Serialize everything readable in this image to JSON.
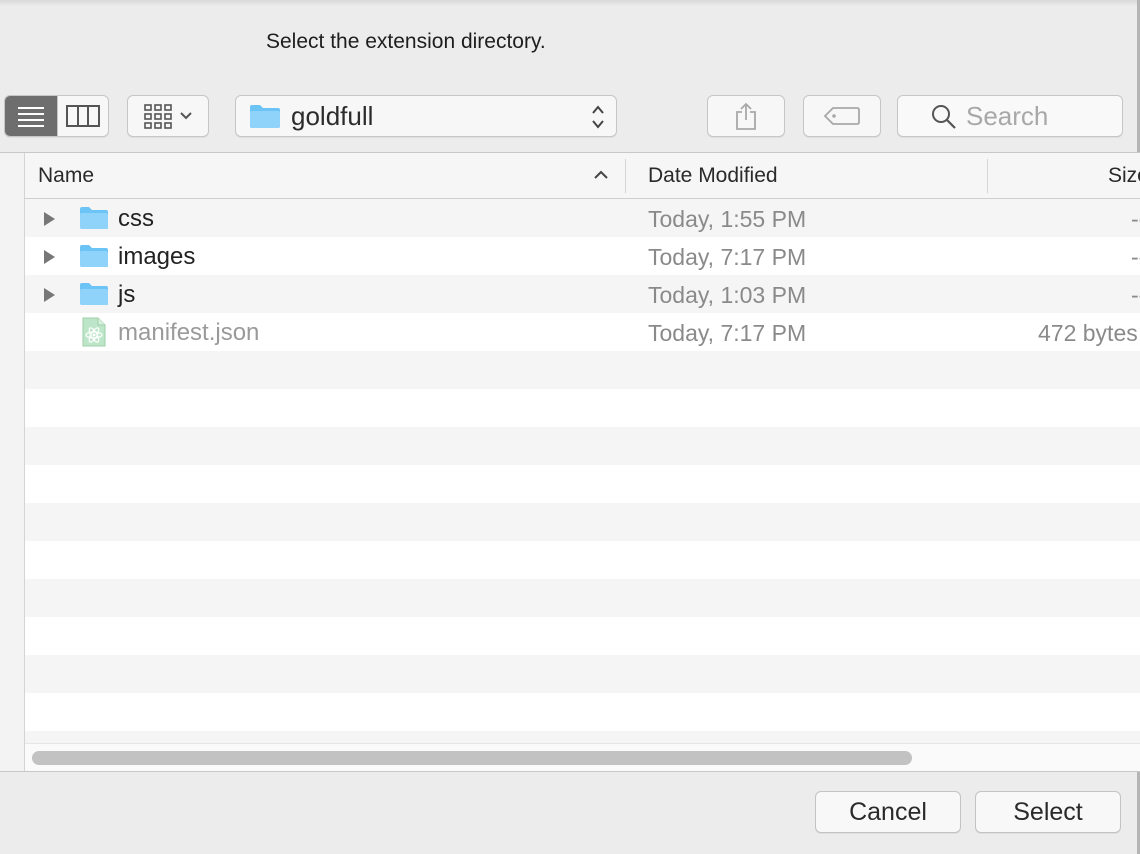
{
  "dialog": {
    "prompt": "Select the extension directory."
  },
  "toolbar": {
    "view_modes": [
      {
        "name": "list-view",
        "icon": "list-icon",
        "active": true
      },
      {
        "name": "column-view",
        "icon": "columns-icon",
        "active": false
      }
    ],
    "arrange_icon": "grid-icon",
    "path_popup": {
      "label": "goldfull",
      "icon": "folder-icon"
    },
    "share_icon": "share-icon",
    "tag_icon": "tag-icon",
    "search": {
      "placeholder": "Search",
      "value": ""
    }
  },
  "browser": {
    "columns": {
      "name": "Name",
      "date_modified": "Date Modified",
      "size": "Size"
    },
    "sort": {
      "column": "Name",
      "direction": "ascending"
    },
    "rows": [
      {
        "name": "css",
        "type": "folder",
        "date": "Today, 1:55 PM",
        "size": "--",
        "enabled": true
      },
      {
        "name": "images",
        "type": "folder",
        "date": "Today, 7:17 PM",
        "size": "--",
        "enabled": true
      },
      {
        "name": "js",
        "type": "folder",
        "date": "Today, 1:03 PM",
        "size": "--",
        "enabled": true
      },
      {
        "name": "manifest.json",
        "type": "file",
        "date": "Today, 7:17 PM",
        "size": "472 bytes",
        "enabled": false
      }
    ]
  },
  "footer": {
    "cancel_label": "Cancel",
    "select_label": "Select"
  },
  "colors": {
    "folder_blue": "#6cc3f5",
    "dialog_bg": "#ececec",
    "stripe": "#f5f5f5"
  }
}
